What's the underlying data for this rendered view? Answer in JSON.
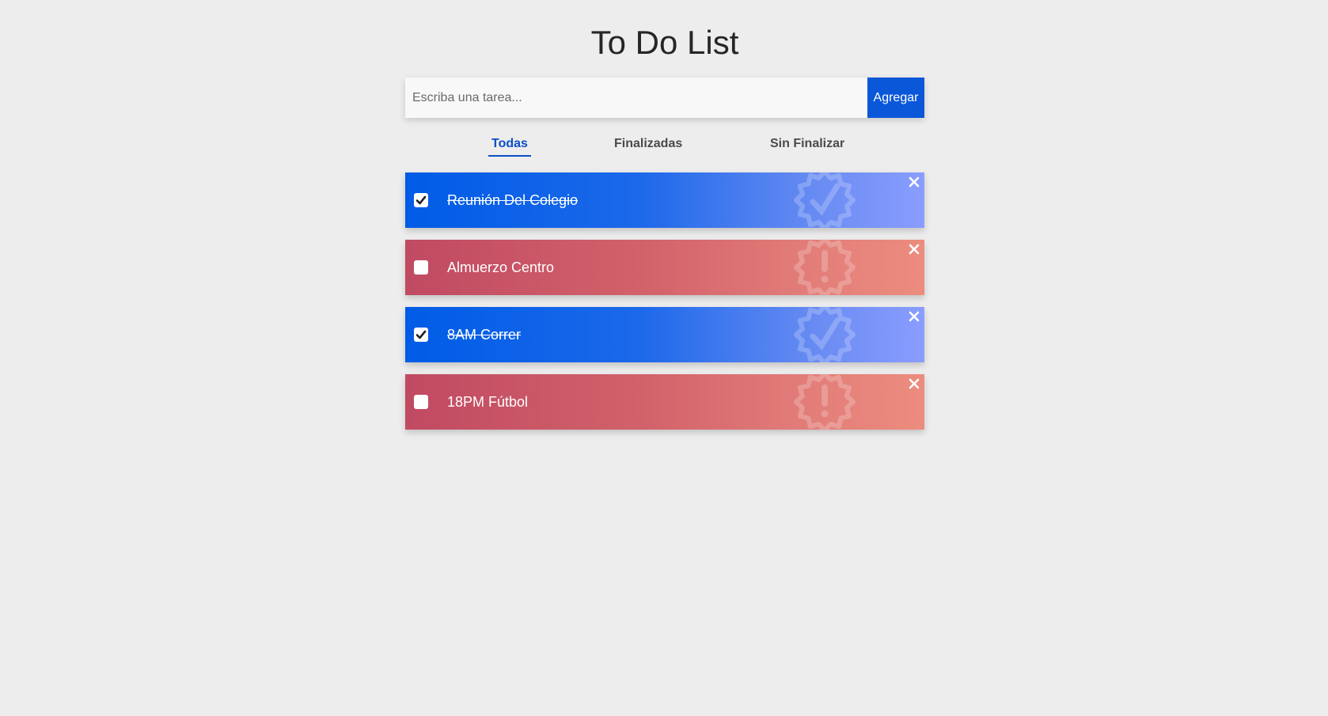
{
  "app": {
    "title": "To Do List"
  },
  "add_form": {
    "placeholder": "Escriba una tarea...",
    "button_label": "Agregar"
  },
  "filters": {
    "all": "Todas",
    "done": "Finalizadas",
    "pending": "Sin Finalizar",
    "active": "all"
  },
  "tasks": [
    {
      "text": "Reunión Del Colegio",
      "completed": true
    },
    {
      "text": "Almuerzo Centro",
      "completed": false
    },
    {
      "text": "8AM Correr",
      "completed": true
    },
    {
      "text": "18PM Fútbol",
      "completed": false
    }
  ],
  "colors": {
    "accent": "#0a57d9",
    "done_gradient_start": "#005ce6",
    "done_gradient_end": "#8a9dff",
    "pending_gradient_start": "#c04a62",
    "pending_gradient_end": "#ec8c7e"
  },
  "icons": {
    "done_badge": "badge-check-icon",
    "pending_badge": "badge-alert-icon",
    "checkbox_checked": "checkmark-icon",
    "close": "close-icon"
  }
}
